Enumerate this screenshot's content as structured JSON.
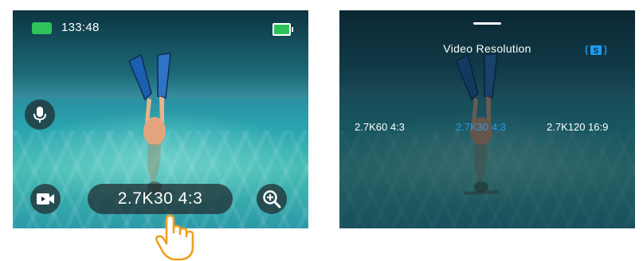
{
  "left_screen": {
    "status_time": "133:48",
    "selected_resolution": "2.7K30 4:3",
    "icons": {
      "battery_status": "battery-icon",
      "camera_battery": "camera-battery-icon",
      "mic": "microphone-icon",
      "playback": "video-playback-icon",
      "zoom": "zoom-in-icon",
      "tap": "tap-hand-icon"
    }
  },
  "right_screen": {
    "menu_title": "Video Resolution",
    "options": [
      "2.7K60 4:3",
      "2.7K30 4:3",
      "2.7K120 16:9"
    ],
    "selected_index": 1,
    "mode_badge": "S",
    "icons": {
      "mode_badge": "steady-mode-badge-icon"
    }
  },
  "colors": {
    "accent": "#1f9cf0",
    "battery_green": "#2fc25b",
    "hand_outline": "#f0a020",
    "pill_bg": "#1e282d"
  }
}
